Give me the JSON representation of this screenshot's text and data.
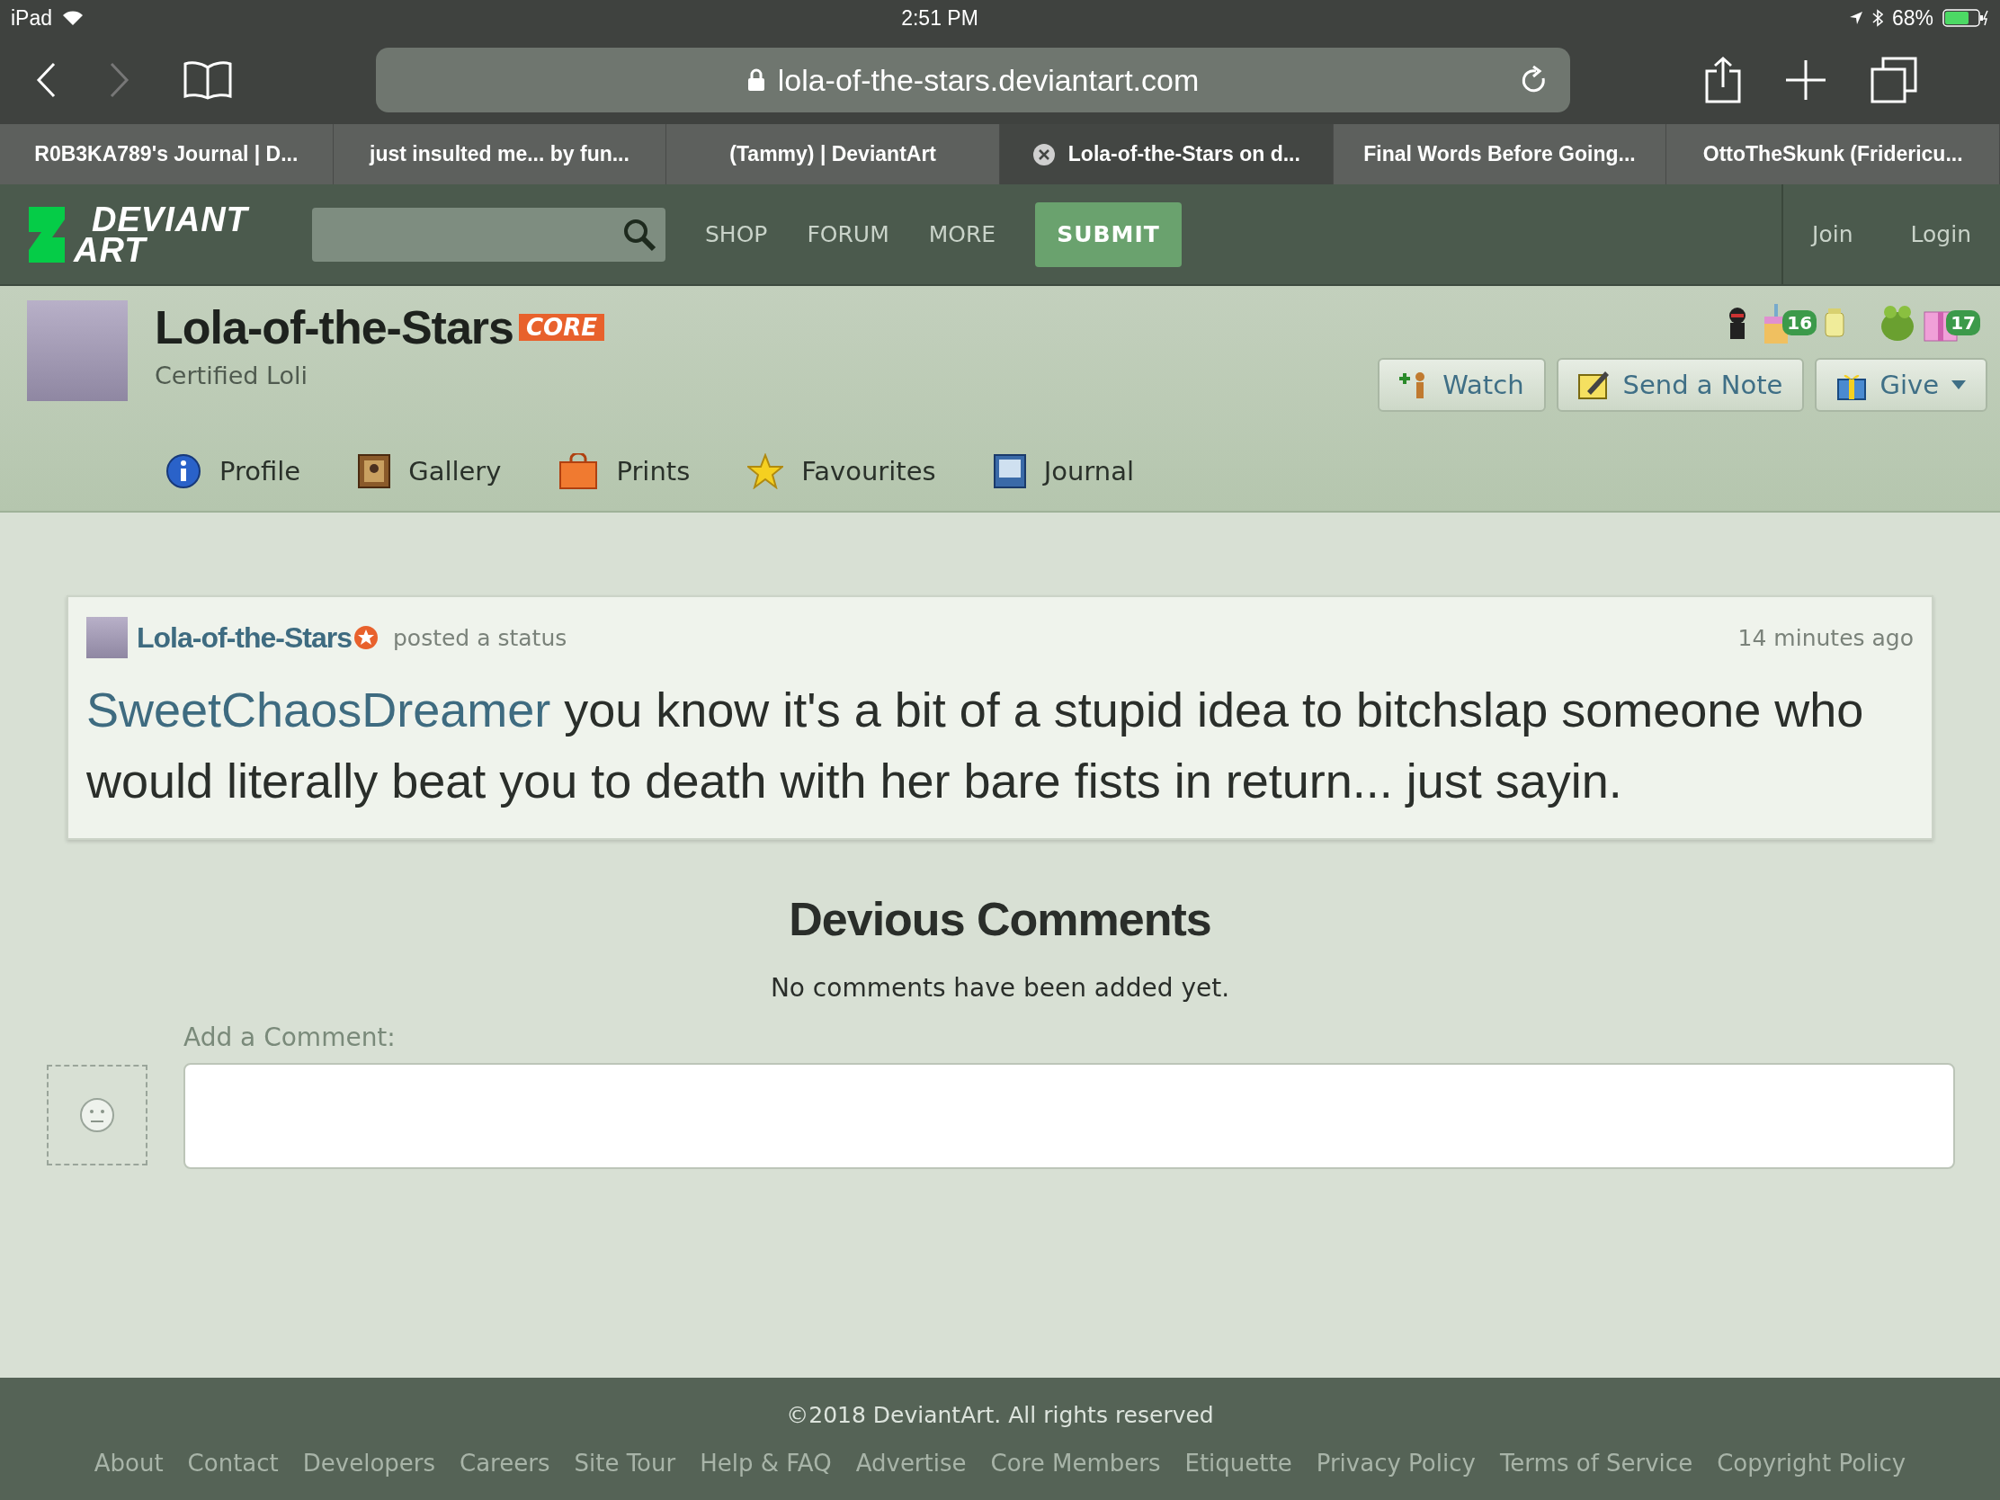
{
  "status_bar": {
    "device": "iPad",
    "time": "2:51 PM",
    "battery": "68%"
  },
  "browser": {
    "url": "lola-of-the-stars.deviantart.com",
    "tabs": [
      {
        "title": "R0B3KA789's Journal | D...",
        "selected": false
      },
      {
        "title": "just insulted me... by fun...",
        "selected": false
      },
      {
        "title": "(Tammy) | DeviantArt",
        "selected": false
      },
      {
        "title": "Lola-of-the-Stars on d...",
        "selected": true
      },
      {
        "title": "Final Words Before Going...",
        "selected": false
      },
      {
        "title": "OttoTheSkunk (Fridericu...",
        "selected": false
      }
    ]
  },
  "site_nav": {
    "logo": [
      "DEVIANT",
      "ART"
    ],
    "links": [
      "SHOP",
      "FORUM",
      "MORE"
    ],
    "submit": "SUBMIT",
    "account_links": [
      "Join",
      "Login"
    ]
  },
  "profile": {
    "name": "Lola-of-the-Stars",
    "badge": "CORE",
    "tagline": "Certified Loli",
    "badge_counts": [
      "16",
      "17"
    ],
    "actions": [
      {
        "kind": "watch",
        "label": "Watch"
      },
      {
        "kind": "note",
        "label": "Send a Note"
      },
      {
        "kind": "give",
        "label": "Give"
      }
    ],
    "tabs": [
      {
        "kind": "profile",
        "label": "Profile",
        "selected": false
      },
      {
        "kind": "gallery",
        "label": "Gallery",
        "selected": false
      },
      {
        "kind": "prints",
        "label": "Prints",
        "selected": false
      },
      {
        "kind": "favourites",
        "label": "Favourites",
        "selected": false
      },
      {
        "kind": "journal",
        "label": "Journal",
        "selected": false
      }
    ]
  },
  "post": {
    "author": "Lola-of-the-Stars",
    "action": "posted a status",
    "time": "14 minutes ago",
    "mention": "SweetChaosDreamer",
    "text": "you know it's a bit of a stupid idea to bitchslap someone who would literally beat you to death with her bare fists in return... just sayin."
  },
  "comments": {
    "heading": "Devious Comments",
    "empty": "No comments have been added yet.",
    "add_label": "Add a Comment:"
  },
  "footer": {
    "copyright": "©2018 DeviantArt. All rights reserved",
    "links": [
      "About",
      "Contact",
      "Developers",
      "Careers",
      "Site Tour",
      "Help & FAQ",
      "Advertise",
      "Core Members",
      "Etiquette",
      "Privacy Policy",
      "Terms of Service",
      "Copyright Policy"
    ]
  }
}
